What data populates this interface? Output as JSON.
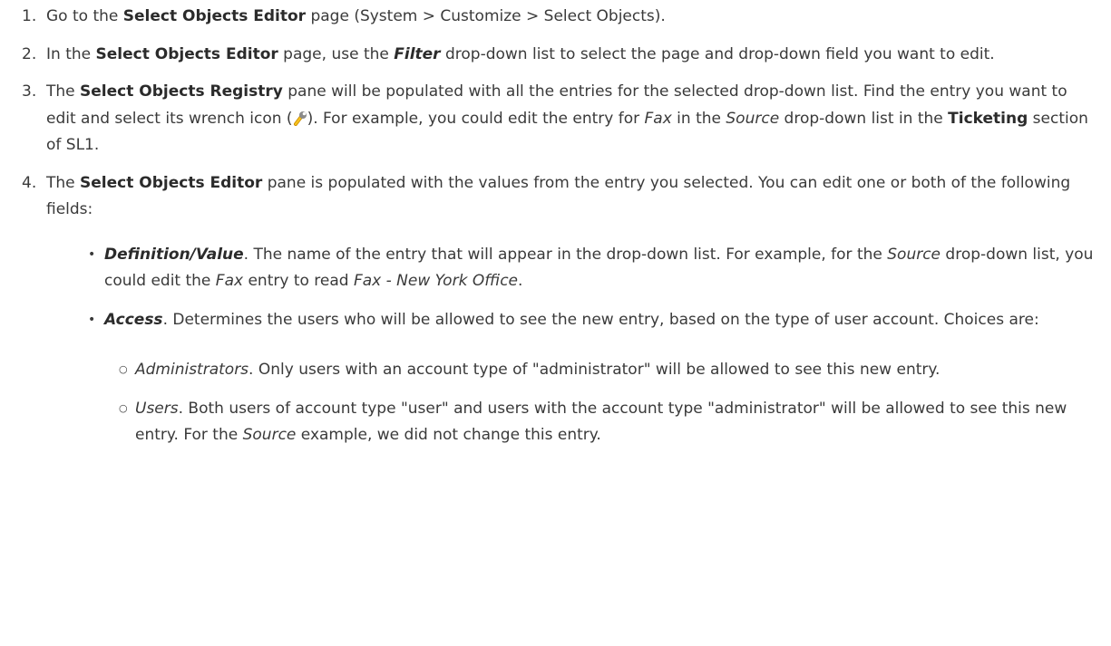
{
  "steps": [
    {
      "num": "1.",
      "a": "Go to the ",
      "b": "Select Objects Editor",
      "c": " page (System > Customize > Select Objects)."
    },
    {
      "num": "2.",
      "a": "In the ",
      "b": "Select Objects Editor",
      "c": " page, use the ",
      "d": "Filter",
      "e": " drop-down list to select the page and drop-down field you want to edit."
    },
    {
      "num": "3.",
      "a": "The ",
      "b": "Select Objects Registry",
      "c": " pane will be populated with all the entries for the selected drop-down list. Find the entry you want to edit and select its wrench icon (",
      "icon": "wrench-icon",
      "d": "). For example, you could edit the entry for ",
      "e": "Fax",
      "f": " in the ",
      "g": "Source",
      "h": " drop-down list in the ",
      "i": "Ticketing",
      "j": " section of SL1."
    },
    {
      "num": "4.",
      "a": "The ",
      "b": "Select Objects Editor",
      "c": " pane is populated with the values from the entry you selected. You can edit one or both of the following fields:"
    }
  ],
  "fields": [
    {
      "name": "Definition/Value",
      "a": ". The name of the entry that will appear in the drop-down list. For example, for the ",
      "b": "Source",
      "c": " drop-down list, you could edit the ",
      "d": "Fax",
      "e": " entry to read ",
      "f": "Fax - New York Office",
      "g": "."
    },
    {
      "name": "Access",
      "a": ". Determines the users who will be allowed to see the new entry, based on the type of user account. Choices are:"
    }
  ],
  "choices": [
    {
      "name": "Administrators",
      "a": ". Only users with an account type of \"administrator\" will be allowed to see this new entry."
    },
    {
      "name": "Users",
      "a": ". Both users of account type \"user\" and users with the account type \"administrator\" will be allowed to see this new entry. For the ",
      "b": "Source",
      "c": " example, we did not change this entry."
    }
  ],
  "markers": {
    "bullet": "•",
    "sub_bullet": "○"
  },
  "colors": {
    "text": "#3a3a3a",
    "wrench_handle": "#f0b400"
  }
}
